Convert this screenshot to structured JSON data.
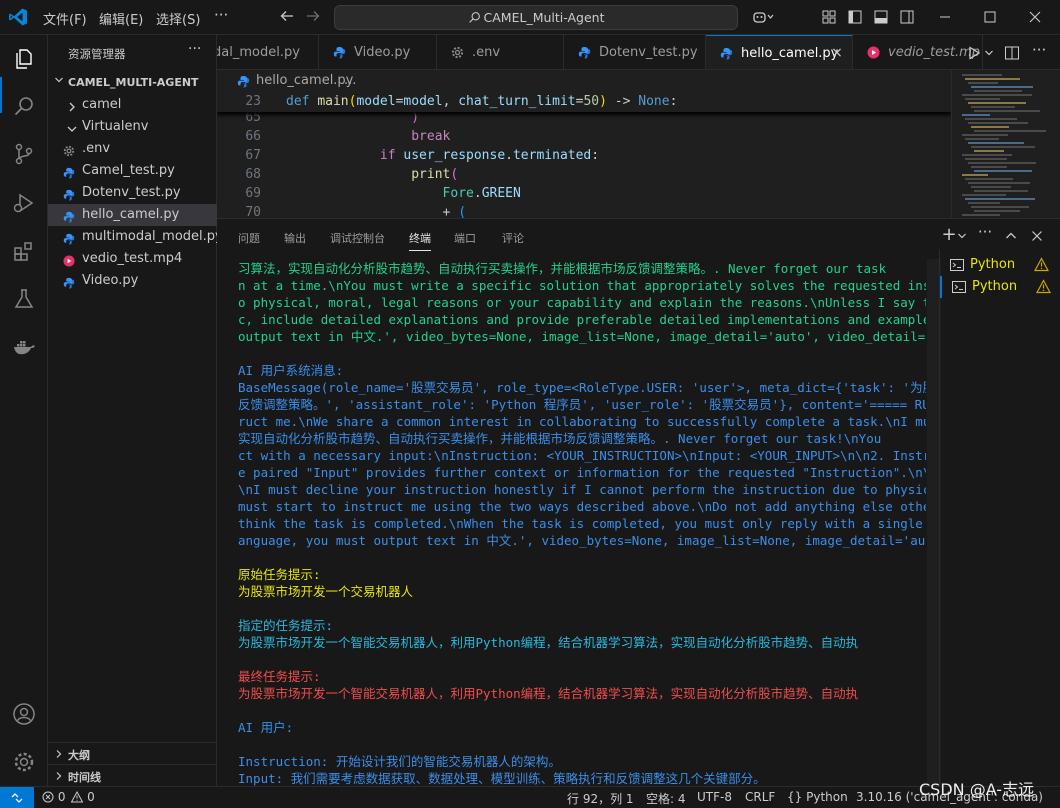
{
  "titlebar": {
    "menus": [
      "文件(F)",
      "编辑(E)",
      "选择(S)"
    ],
    "more": "···",
    "search": "CAMEL_Multi-Agent"
  },
  "sidebar": {
    "title": "资源管理器",
    "more": "···",
    "root": "CAMEL_MULTI-AGENT",
    "items": [
      {
        "label": "camel",
        "kind": "folder"
      },
      {
        "label": "Virtualenv",
        "kind": "folder-open"
      },
      {
        "label": ".env",
        "kind": "gear"
      },
      {
        "label": "Camel_test.py",
        "kind": "python"
      },
      {
        "label": "Dotenv_test.py",
        "kind": "python"
      },
      {
        "label": "hello_camel.py",
        "kind": "python",
        "selected": true
      },
      {
        "label": "multimodal_model.py",
        "kind": "python"
      },
      {
        "label": "vedio_test.mp4",
        "kind": "media"
      },
      {
        "label": "Video.py",
        "kind": "python"
      }
    ],
    "outline": "大纲",
    "timeline": "时间线"
  },
  "tabs": [
    {
      "label": "dal_model.py",
      "kind": "python"
    },
    {
      "label": "Video.py",
      "kind": "python"
    },
    {
      "label": ".env",
      "kind": "gear"
    },
    {
      "label": "Dotenv_test.py",
      "kind": "python"
    },
    {
      "label": "hello_camel.py",
      "kind": "python",
      "active": true,
      "close": "×"
    },
    {
      "label": "vedio_test.mp",
      "kind": "media",
      "italic": true
    }
  ],
  "breadcrumb": {
    "file": "hello_camel.py",
    "sep": "..."
  },
  "code": {
    "sticky": {
      "line": "23",
      "parts": [
        [
          "def ",
          "k-def"
        ],
        [
          "main",
          "k-fn"
        ],
        [
          "(",
          "k-br1"
        ],
        [
          "model",
          "k-par"
        ],
        [
          "=",
          ""
        ],
        [
          "model",
          "k-par"
        ],
        [
          ", ",
          ""
        ],
        [
          "chat_turn_limit",
          "k-par"
        ],
        [
          "=",
          ""
        ],
        [
          "50",
          "k-num"
        ],
        [
          ")",
          "k-br1"
        ],
        [
          " -> ",
          ""
        ],
        [
          "None",
          "k-none"
        ],
        [
          ":",
          ""
        ]
      ]
    },
    "lines": [
      {
        "line": "65",
        "parts": [
          [
            "                ",
            ""
          ],
          [
            ")",
            "k-br2"
          ]
        ]
      },
      {
        "line": "66",
        "parts": [
          [
            "                ",
            ""
          ],
          [
            "break",
            "k-ctl"
          ]
        ]
      },
      {
        "line": "67",
        "parts": [
          [
            "            ",
            ""
          ],
          [
            "if ",
            "k-ctl"
          ],
          [
            "user_response",
            "k-par"
          ],
          [
            ".",
            ""
          ],
          [
            "terminated",
            "k-par"
          ],
          [
            ":",
            ""
          ]
        ]
      },
      {
        "line": "68",
        "parts": [
          [
            "                ",
            ""
          ],
          [
            "print",
            "k-fn"
          ],
          [
            "(",
            "k-br2"
          ]
        ]
      },
      {
        "line": "69",
        "parts": [
          [
            "                    ",
            ""
          ],
          [
            "Fore",
            "k-cls"
          ],
          [
            ".",
            ""
          ],
          [
            "GREEN",
            "k-par"
          ]
        ]
      },
      {
        "line": "70",
        "parts": [
          [
            "                    ",
            ""
          ],
          [
            "+ ",
            ""
          ],
          [
            "(",
            "k-br3"
          ]
        ]
      }
    ]
  },
  "panel": {
    "tabs": [
      "问题",
      "输出",
      "调试控制台",
      "终端",
      "端口",
      "评论"
    ],
    "active_tab": "终端",
    "add": "+",
    "terminals": [
      {
        "label": "Python",
        "selected": false
      },
      {
        "label": "Python",
        "selected": true
      }
    ]
  },
  "terminal": [
    {
      "text": "习算法，实现自动化分析股市趋势、自动执行买卖操作，并能根据市场反馈调整策略。. Never forget our task",
      "color": "c-green"
    },
    {
      "text": "n at a time.\\nYou must write a specific solution that appropriately solves the requested instructi",
      "color": "c-green"
    },
    {
      "text": "o physical, moral, legal reasons or your capability and explain the reasons.\\nUnless I say the task",
      "color": "c-green"
    },
    {
      "text": "c, include detailed explanations and provide preferable detailed implementations and examples and",
      "color": "c-green"
    },
    {
      "text": "output text in 中文.', video_bytes=None, image_list=None, image_detail='auto', video_detail='low',",
      "color": "c-green"
    },
    {
      "text": "",
      "color": "c-green"
    },
    {
      "text": "AI 用户系统消息:",
      "color": "c-blue"
    },
    {
      "text": "BaseMessage(role_name='股票交易员', role_type=<RoleType.USER: 'user'>, meta_dict={'task': '为股票市",
      "color": "c-blue"
    },
    {
      "text": "反馈调整策略。', 'assistant_role': 'Python 程序员', 'user_role': '股票交易员'}, content='===== RUL",
      "color": "c-blue"
    },
    {
      "text": "ruct me.\\nWe share a common interest in collaborating to successfully complete a task.\\nI must hel",
      "color": "c-blue"
    },
    {
      "text": "实现自动化分析股市趋势、自动执行买卖操作，并能根据市场反馈调整策略。. Never forget our task!\\nYou",
      "color": "c-blue"
    },
    {
      "text": "ct with a necessary input:\\nInstruction: <YOUR_INSTRUCTION>\\nInput: <YOUR_INPUT>\\n\\n2. Instruct wi",
      "color": "c-blue"
    },
    {
      "text": "e paired \"Input\" provides further context or information for the requested \"Instruction\".\\n\\nYou m",
      "color": "c-blue"
    },
    {
      "text": "\\nI must decline your instruction honestly if I cannot perform the instruction due to physical, mo",
      "color": "c-blue"
    },
    {
      "text": "must start to instruct me using the two ways described above.\\nDo not add anything else other than",
      "color": "c-blue"
    },
    {
      "text": "think the task is completed.\\nWhen the task is completed, you must only reply with a single word <",
      "color": "c-blue"
    },
    {
      "text": "anguage, you must output text in 中文.', video_bytes=None, image_list=None, image_detail='auto', v",
      "color": "c-blue"
    },
    {
      "text": "",
      "color": "c-blue"
    },
    {
      "text": "原始任务提示:",
      "color": "c-yellow"
    },
    {
      "text": "为股票市场开发一个交易机器人",
      "color": "c-yellow"
    },
    {
      "text": "",
      "color": "c-yellow"
    },
    {
      "text": "指定的任务提示:",
      "color": "c-cyan"
    },
    {
      "text": "为股票市场开发一个智能交易机器人，利用Python编程，结合机器学习算法，实现自动化分析股市趋势、自动执",
      "color": "c-cyan"
    },
    {
      "text": "",
      "color": "c-cyan"
    },
    {
      "text": "最终任务提示:",
      "color": "c-red"
    },
    {
      "text": "为股票市场开发一个智能交易机器人，利用Python编程，结合机器学习算法，实现自动化分析股市趋势、自动执",
      "color": "c-red"
    },
    {
      "text": "",
      "color": "c-red"
    },
    {
      "text": "AI 用户:",
      "color": "c-blue"
    },
    {
      "text": "",
      "color": "c-blue"
    },
    {
      "text": "Instruction: 开始设计我们的智能交易机器人的架构。",
      "color": "c-blue"
    },
    {
      "text": "Input: 我们需要考虑数据获取、数据处理、模型训练、策略执行和反馈调整这几个关键部分。",
      "color": "c-blue"
    }
  ],
  "statusbar": {
    "errors": "0",
    "warnings": "0",
    "position": "行 92，列 1",
    "spaces": "空格: 4",
    "encoding": "UTF-8",
    "eol": "CRLF",
    "language": "Python",
    "interpreter": "3.10.16 ('camel_agent': conda)"
  },
  "watermark": "CSDN @A-志远",
  "colors": {
    "accent": "#0078d4",
    "python_icon": "#3794ff",
    "media_icon": "#e8316b",
    "warning": "#cca700"
  }
}
